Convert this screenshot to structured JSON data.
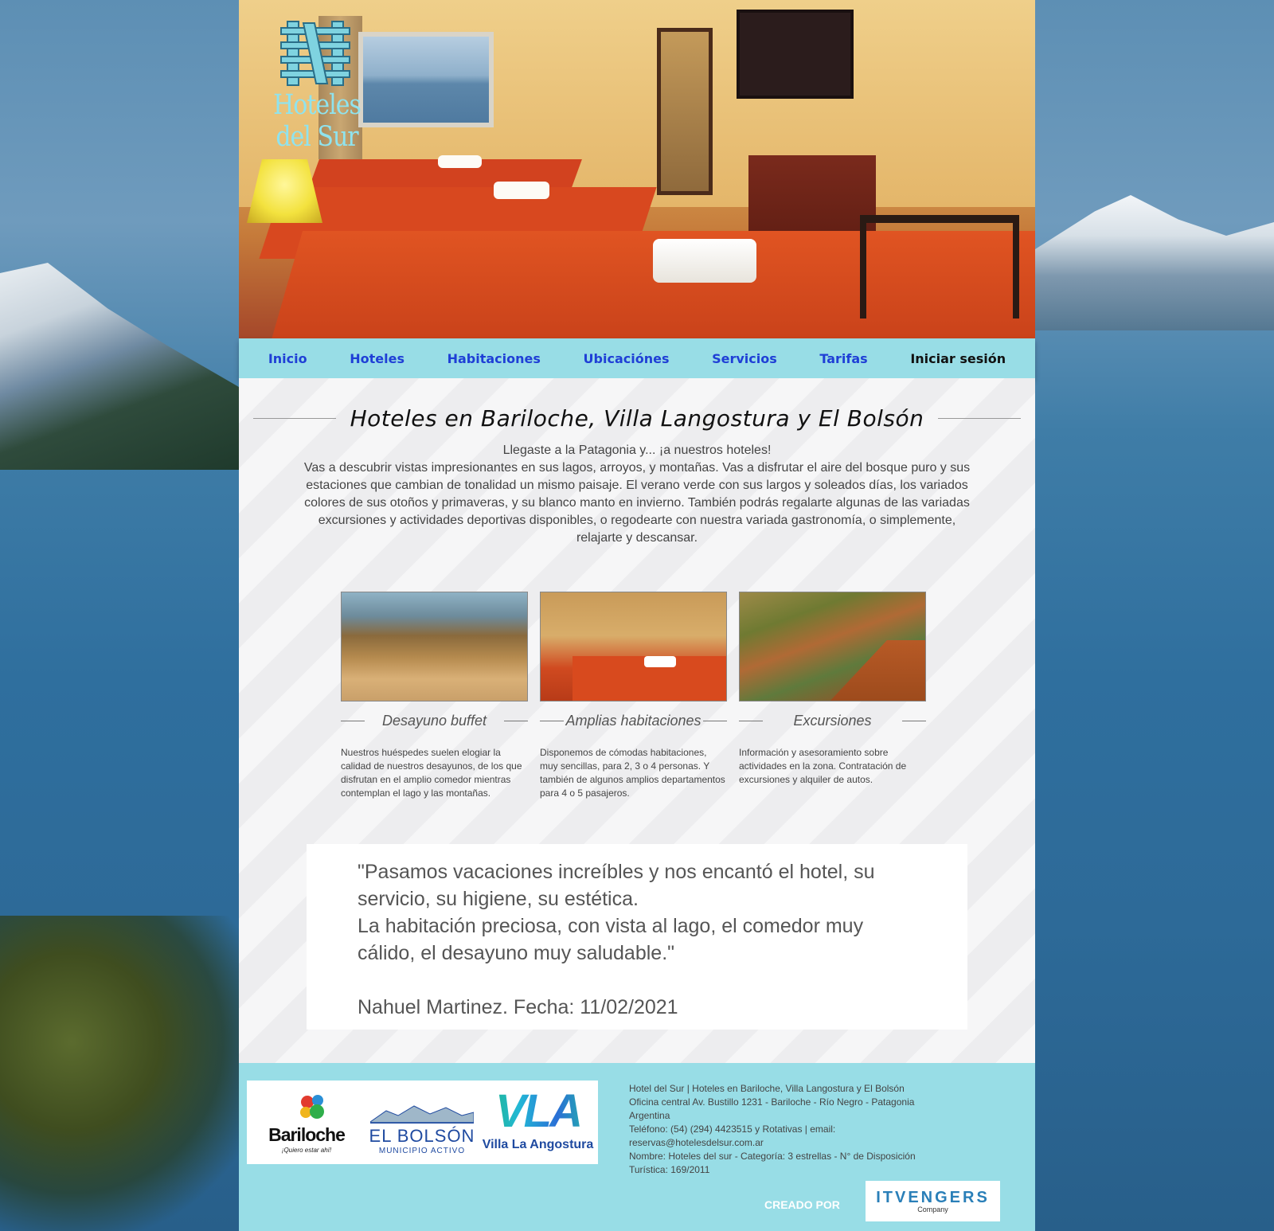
{
  "brand": {
    "logo_text": "Hoteles del Sur"
  },
  "nav": {
    "items": [
      "Inicio",
      "Hoteles",
      "Habitaciones",
      "Ubicaciónes",
      "Servicios",
      "Tarifas"
    ],
    "login": "Iniciar sesión"
  },
  "main": {
    "title": "Hoteles en Bariloche, Villa Langostura y El Bolsón",
    "intro_line1": "Llegaste a la Patagonia y... ¡a nuestros hoteles!",
    "intro_body": "Vas a descubrir vistas impresionantes en sus lagos, arroyos, y montañas. Vas a disfrutar el aire del bosque puro y sus estaciones que cambian de tonalidad un mismo paisaje. El verano verde con sus largos y soleados días, los variados colores de sus otoños y primaveras, y su blanco manto en invierno. También podrás regalarte algunas de las variadas excursiones y actividades deportivas disponibles, o regodearte con nuestra variada gastronomía, o simplemente, relajarte y descansar.",
    "cards": [
      {
        "title": "Desayuno buffet",
        "text": "Nuestros huéspedes suelen elogiar la calidad de nuestros desayunos, de los que disfrutan en el amplio comedor mientras contemplan el lago y las montañas."
      },
      {
        "title": "Amplias habitaciones",
        "text": "Disponemos de cómodas habitaciones, muy sencillas, para 2, 3 o 4 personas. Y también de algunos amplios departamentos para 4 o 5 pasajeros."
      },
      {
        "title": "Excursiones",
        "text": "Información y asesoramiento sobre actividades en la zona. Contratación de excursiones y alquiler de autos."
      }
    ],
    "testimonial": {
      "quote_line1": "\"Pasamos vacaciones increíbles y nos encantó el hotel, su servicio, su higiene, su estética.",
      "quote_line2": "La habitación preciosa, con vista al lago, el comedor muy cálido, el desayuno muy saludable.\"",
      "author": "Nahuel Martinez. Fecha: 11/02/2021"
    }
  },
  "footer": {
    "partners": {
      "bariloche": "Bariloche",
      "bariloche_sub": "¡Quiero estar ahí!",
      "bolson": "EL BOLSÓN",
      "bolson_sub": "MUNICIPIO ACTIVO",
      "vla": "VLA",
      "vla_sub": "Villa La Angostura"
    },
    "info_lines": [
      "Hotel del Sur | Hoteles en Bariloche, Villa Langostura y El Bolsón",
      "Oficina central Av. Bustillo 1231 - Bariloche - Río Negro - Patagonia Argentina",
      "Teléfono: (54) (294) 4423515 y Rotativas | email: reservas@hotelesdelsur.com.ar",
      "Nombre: Hoteles del sur - Categoría: 3 estrellas - N° de Disposición Turística: 169/2011"
    ],
    "created_by": "CREADO POR",
    "company": "ITVENGERS",
    "company_sub": "Company"
  },
  "colors": {
    "nav_bg": "#98dde6",
    "nav_link": "#1f3fd6",
    "footer_bg": "#98dde6"
  }
}
